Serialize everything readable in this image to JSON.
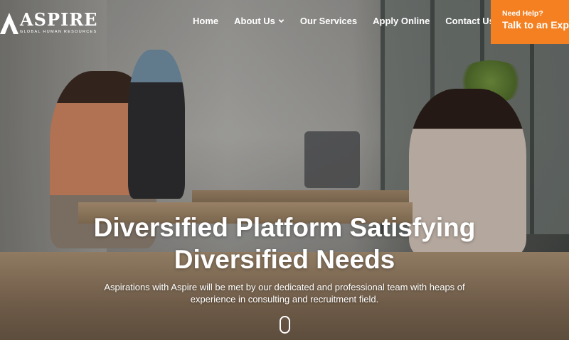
{
  "brand": {
    "name": "ASPIRE",
    "tagline": "GLOBAL HUMAN RESOURCES"
  },
  "nav": {
    "items": [
      {
        "label": "Home"
      },
      {
        "label": "About Us"
      },
      {
        "label": "Our Services"
      },
      {
        "label": "Apply Online"
      },
      {
        "label": "Contact Us"
      }
    ]
  },
  "help": {
    "small": "Need Help?",
    "big": "Talk to an Expert"
  },
  "hero": {
    "headline_line1": "Diversified Platform Satisfying",
    "headline_line2": "Diversified Needs",
    "subtext_line1": "Aspirations with Aspire will be met by our dedicated and professional team with heaps of",
    "subtext_line2": "experience in consulting and recruitment field."
  },
  "colors": {
    "accent": "#f58021",
    "text": "#ffffff"
  }
}
